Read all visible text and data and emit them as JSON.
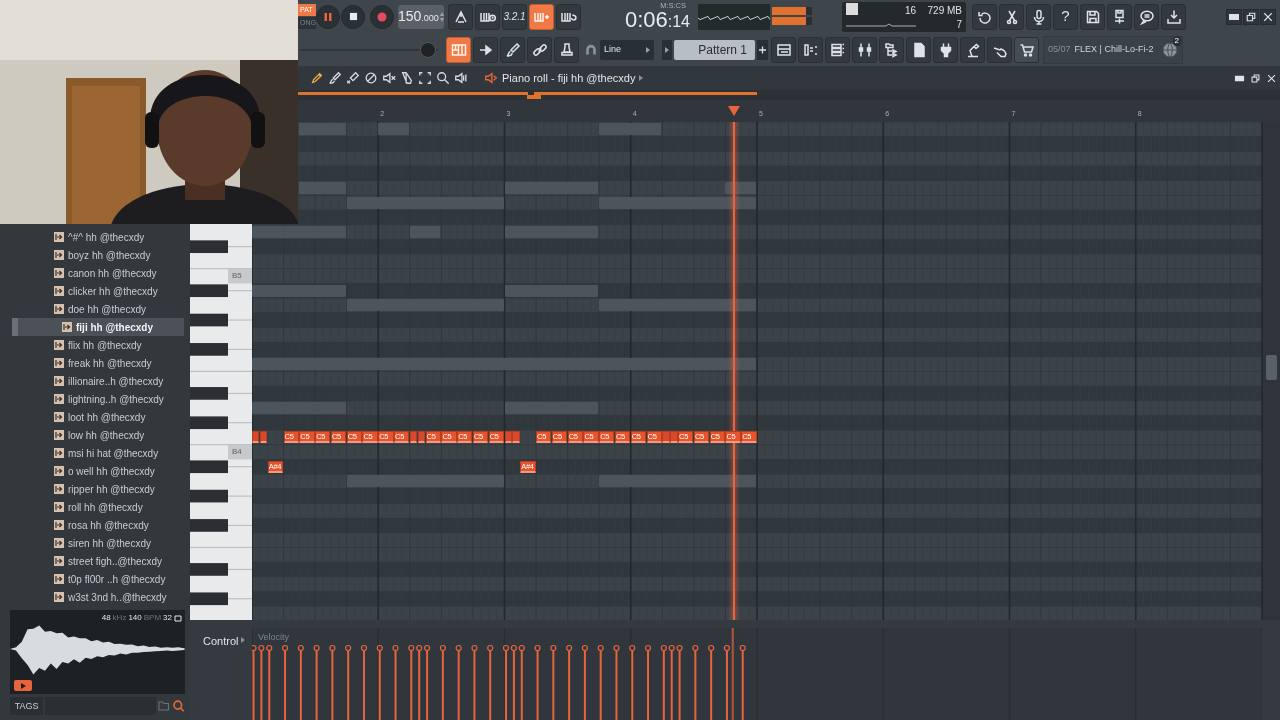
{
  "transport": {
    "modes": [
      {
        "label": "PAT",
        "selected": true
      },
      {
        "label": "ONG",
        "selected": false
      }
    ],
    "playing": true,
    "recording": false,
    "tempo": "150",
    "tempo_fraction": ".000",
    "time": "0:06",
    "time_fraction": ":14",
    "time_format": "M:S:CS"
  },
  "record_buttons": [
    {
      "kind": "metronome",
      "on": false
    },
    {
      "kind": "keyboard-clock",
      "on": false
    },
    {
      "kind": "countdown",
      "label": "3.2.1",
      "on": false
    },
    {
      "kind": "keyboard-plus",
      "on": true
    },
    {
      "kind": "keyboard-loop",
      "on": false
    }
  ],
  "output_meters": [
    {
      "level": 0.85
    },
    {
      "level": 0.85
    }
  ],
  "cpu": {
    "polyphony": "16",
    "memory": "729 MB",
    "voices": "7"
  },
  "app_buttons": [
    {
      "kind": "undo"
    },
    {
      "kind": "scissors"
    },
    {
      "kind": "microphone"
    },
    {
      "kind": "help",
      "label": "?"
    },
    {
      "kind": "save"
    },
    {
      "kind": "save-plus"
    },
    {
      "kind": "chat"
    },
    {
      "kind": "download"
    }
  ],
  "window_controls": [
    {
      "kind": "minimize"
    },
    {
      "kind": "restore"
    },
    {
      "kind": "close"
    }
  ],
  "volume": {
    "level": 0.93
  },
  "edit_buttons": [
    {
      "kind": "piano-roll",
      "on": true
    },
    {
      "kind": "arrow-right",
      "on": false
    },
    {
      "kind": "brush",
      "on": false
    },
    {
      "kind": "link",
      "on": false
    },
    {
      "kind": "stamp",
      "on": false
    }
  ],
  "snap": "Line",
  "pattern": "Pattern 1",
  "view_buttons": [
    {
      "kind": "playlist"
    },
    {
      "kind": "step-sequencer"
    },
    {
      "kind": "channel-rack"
    },
    {
      "kind": "mixer"
    },
    {
      "kind": "folder-tree"
    },
    {
      "kind": "page"
    },
    {
      "kind": "plug"
    },
    {
      "kind": "lamp"
    },
    {
      "kind": "hand"
    },
    {
      "kind": "cart"
    }
  ],
  "hint": {
    "counter": "05/07",
    "text": "FLEX | Chill-Lo-Fi-2",
    "badge": "2"
  },
  "browser": {
    "items": [
      {
        "label": "^#^ hh @thecxdy",
        "selected": false
      },
      {
        "label": "boyz hh @thecxdy",
        "selected": false
      },
      {
        "label": "canon hh @thecxdy",
        "selected": false
      },
      {
        "label": "clicker hh @thecxdy",
        "selected": false
      },
      {
        "label": "doe hh @thecxdy",
        "selected": false
      },
      {
        "label": "fiji hh @thecxdy",
        "selected": true
      },
      {
        "label": "flix hh @thecxdy",
        "selected": false
      },
      {
        "label": "freak hh @thecxdy",
        "selected": false
      },
      {
        "label": "illionaire..h @thecxdy",
        "selected": false
      },
      {
        "label": "lightning..h @thecxdy",
        "selected": false
      },
      {
        "label": "loot hh @thecxdy",
        "selected": false
      },
      {
        "label": "low hh @thecxdy",
        "selected": false
      },
      {
        "label": "msi hi hat @thecxdy",
        "selected": false
      },
      {
        "label": "o well hh @thecxdy",
        "selected": false
      },
      {
        "label": "ripper hh @thecxdy",
        "selected": false
      },
      {
        "label": "roll hh @thecxdy",
        "selected": false
      },
      {
        "label": "rosa hh @thecxdy",
        "selected": false
      },
      {
        "label": "siren hh @thecxdy",
        "selected": false
      },
      {
        "label": "street figh..@thecxdy",
        "selected": false
      },
      {
        "label": "t0p fl00r ..h @thecxdy",
        "selected": false
      },
      {
        "label": "w3st 3nd h..@thecxdy",
        "selected": false
      }
    ],
    "preview": {
      "rate": "48",
      "rate_unit": "kHz",
      "tempo": "140",
      "tempo_unit": "BPM",
      "bits": "32"
    },
    "tags_label": "TAGS"
  },
  "piano_roll": {
    "tools": [
      {
        "kind": "pencil",
        "selected": true
      },
      {
        "kind": "paint-brush",
        "selected": false
      },
      {
        "kind": "delete-brush",
        "selected": false
      },
      {
        "kind": "no-entry",
        "selected": false
      },
      {
        "kind": "mute",
        "selected": false
      },
      {
        "kind": "slice",
        "selected": false
      },
      {
        "kind": "select",
        "selected": false
      },
      {
        "kind": "zoom",
        "selected": false
      },
      {
        "kind": "speaker",
        "selected": false
      }
    ],
    "title": "Piano roll - fiji hh @thecxdy",
    "window_controls": [
      {
        "kind": "minimize"
      },
      {
        "kind": "restore"
      },
      {
        "kind": "close"
      }
    ],
    "bars": [
      "2",
      "3",
      "4",
      "5",
      "6",
      "7",
      "8"
    ],
    "playhead": {
      "level": 0.476
    },
    "key_labels": [
      "B5",
      "B4"
    ],
    "notes": [
      {
        "kind": "short"
      },
      {
        "kind": "short"
      },
      {
        "kind": "long",
        "label": "A#4"
      },
      {
        "kind": "long",
        "label": "C5"
      },
      {
        "kind": "long",
        "label": "C5"
      },
      {
        "kind": "long",
        "label": "C5"
      },
      {
        "kind": "long",
        "label": "C5"
      },
      {
        "kind": "long",
        "label": "C5"
      },
      {
        "kind": "long",
        "label": "C5"
      },
      {
        "kind": "long",
        "label": "C5"
      },
      {
        "kind": "long",
        "label": "C5"
      },
      {
        "kind": "short"
      },
      {
        "kind": "short"
      },
      {
        "kind": "long",
        "label": "C5"
      },
      {
        "kind": "long",
        "label": "C5"
      },
      {
        "kind": "long",
        "label": "C5"
      },
      {
        "kind": "long",
        "label": "C5"
      },
      {
        "kind": "long",
        "label": "C5"
      },
      {
        "kind": "short"
      },
      {
        "kind": "short"
      },
      {
        "kind": "long",
        "label": "A#4"
      },
      {
        "kind": "long",
        "label": "C5"
      },
      {
        "kind": "long",
        "label": "C5"
      },
      {
        "kind": "long",
        "label": "C5"
      },
      {
        "kind": "long",
        "label": "C5"
      },
      {
        "kind": "long",
        "label": "C5"
      },
      {
        "kind": "long",
        "label": "C5"
      },
      {
        "kind": "long",
        "label": "C5"
      },
      {
        "kind": "long",
        "label": "C5"
      },
      {
        "kind": "short"
      },
      {
        "kind": "short"
      },
      {
        "kind": "long",
        "label": "C5"
      },
      {
        "kind": "long",
        "label": "C5"
      },
      {
        "kind": "long",
        "label": "C5"
      },
      {
        "kind": "long",
        "label": "C5"
      },
      {
        "kind": "long",
        "label": "C5"
      }
    ],
    "control_label": "Control",
    "control_target": "Velocity"
  }
}
